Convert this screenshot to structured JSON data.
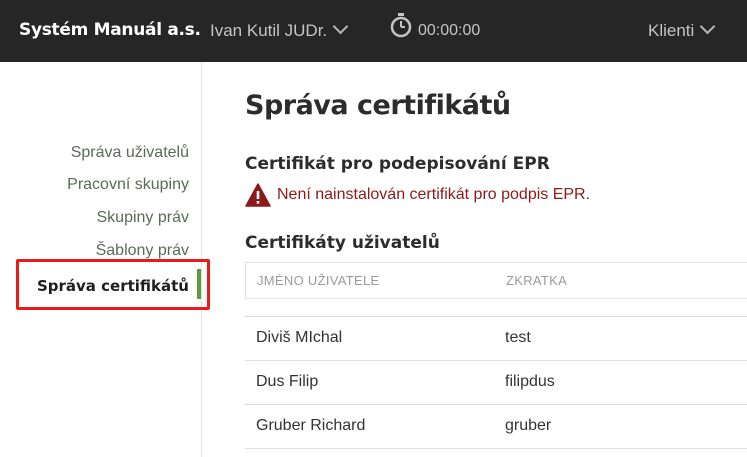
{
  "header": {
    "brand": "Systém Manuál a.s.",
    "user": "Ivan Kutil JUDr.",
    "timer": "00:00:00",
    "clients": "Klienti"
  },
  "sidebar": {
    "items": [
      {
        "label": "Správa uživatelů"
      },
      {
        "label": "Pracovní skupiny"
      },
      {
        "label": "Skupiny práv"
      },
      {
        "label": "Šablony práv"
      },
      {
        "label": "Správa certifikátů",
        "active": true
      }
    ]
  },
  "main": {
    "title": "Správa certifikátů",
    "epr_section_title": "Certifikát pro podepisování EPR",
    "epr_warning": "Není nainstalován certifikát pro podpis EPR.",
    "users_section_title": "Certifikáty uživatelů",
    "table": {
      "columns": [
        "JMÉNO UŽIVATELE",
        "ZKRATKA"
      ],
      "rows": [
        [
          "Diviš MIchal",
          "test"
        ],
        [
          "Dus Filip",
          "filipdus"
        ],
        [
          "Gruber Richard",
          "gruber"
        ]
      ]
    }
  },
  "colors": {
    "topbar": "#262626",
    "active_accent": "#5a9c3a",
    "warning": "#8b1a1a",
    "highlight": "#e81c1c"
  }
}
